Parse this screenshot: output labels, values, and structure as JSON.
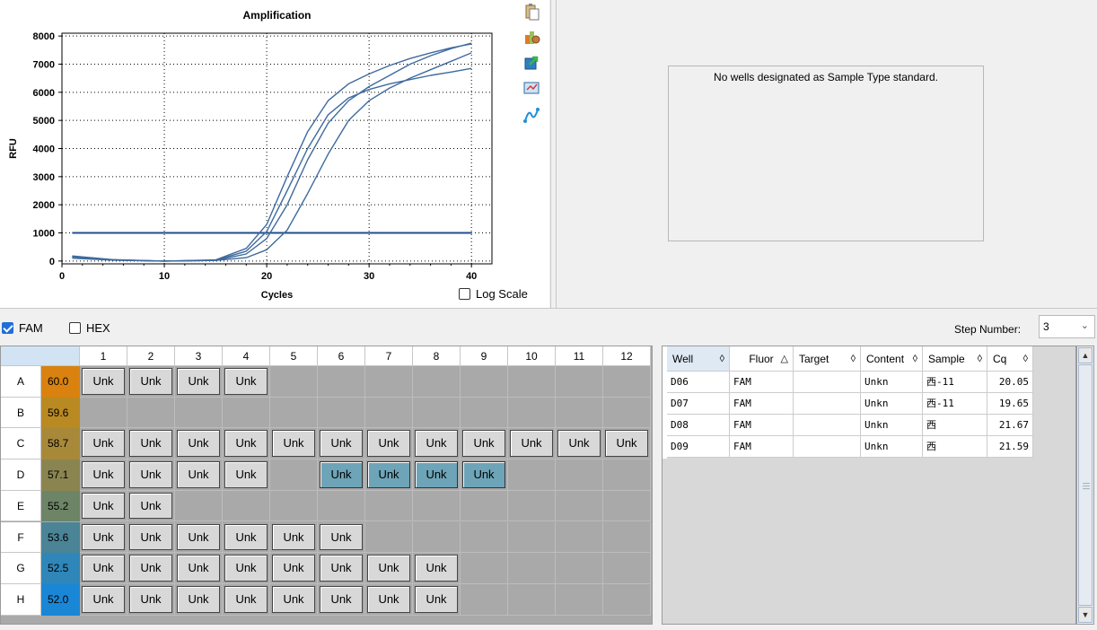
{
  "chart": {
    "title": "Amplification",
    "ylabel": "RFU",
    "xlabel": "Cycles",
    "y_ticks": [
      "8000",
      "7000",
      "6000",
      "5000",
      "4000",
      "3000",
      "2000",
      "1000",
      "0"
    ],
    "x_ticks": [
      "0",
      "10",
      "20",
      "30",
      "40"
    ],
    "log_scale_label": "Log Scale",
    "log_scale_checked": false
  },
  "chart_data": {
    "type": "line",
    "title": "Amplification",
    "xlabel": "Cycles",
    "ylabel": "RFU",
    "xlim": [
      0,
      42
    ],
    "ylim": [
      -100,
      8100
    ],
    "grid": true,
    "threshold": 1000,
    "curves_note": "4 sigmoid curves (wells D06, D07, D08, D09)",
    "series": [
      {
        "x": [
          1,
          5,
          10,
          15,
          18,
          20,
          22,
          24,
          26,
          28,
          30,
          32,
          34,
          36,
          38,
          40
        ],
        "y": [
          150,
          40,
          0,
          20,
          250,
          800,
          2000,
          3600,
          4900,
          5700,
          6200,
          6600,
          7000,
          7300,
          7550,
          7750
        ]
      },
      {
        "x": [
          1,
          5,
          10,
          15,
          18,
          20,
          22,
          24,
          26,
          28,
          30,
          32,
          34,
          36,
          38,
          40
        ],
        "y": [
          100,
          30,
          0,
          30,
          350,
          1050,
          2500,
          4000,
          5200,
          5800,
          6100,
          6300,
          6450,
          6600,
          6720,
          6850
        ]
      },
      {
        "x": [
          1,
          5,
          10,
          15,
          18,
          20,
          22,
          24,
          26,
          28,
          30,
          32,
          34,
          36,
          38,
          40
        ],
        "y": [
          150,
          40,
          0,
          20,
          120,
          400,
          1100,
          2400,
          3800,
          5000,
          5700,
          6150,
          6500,
          6800,
          7100,
          7400
        ]
      },
      {
        "x": [
          1,
          5,
          10,
          15,
          18,
          20,
          22,
          24,
          26,
          28,
          30,
          32,
          34,
          36,
          38,
          40
        ],
        "y": [
          180,
          50,
          0,
          40,
          450,
          1300,
          3000,
          4600,
          5700,
          6300,
          6650,
          6950,
          7200,
          7400,
          7580,
          7720
        ]
      }
    ]
  },
  "standard_panel": {
    "message": "No wells designated as Sample Type standard."
  },
  "fluors": [
    {
      "label": "FAM",
      "checked": true
    },
    {
      "label": "HEX",
      "checked": false
    }
  ],
  "step": {
    "label": "Step Number:",
    "value": "3"
  },
  "plate": {
    "columns": [
      "1",
      "2",
      "3",
      "4",
      "5",
      "6",
      "7",
      "8",
      "9",
      "10",
      "11",
      "12"
    ],
    "rows": [
      {
        "label": "A",
        "temp": "60.0",
        "color": "#d9820f",
        "wells": [
          "Unk",
          "Unk",
          "Unk",
          "Unk",
          "",
          "",
          "",
          "",
          "",
          "",
          "",
          ""
        ],
        "selected": []
      },
      {
        "label": "B",
        "temp": "59.6",
        "color": "#b98a22",
        "wells": [
          "",
          "",
          "",
          "",
          "",
          "",
          "",
          "",
          "",
          "",
          "",
          ""
        ],
        "selected": []
      },
      {
        "label": "C",
        "temp": "58.7",
        "color": "#a8893a",
        "wells": [
          "Unk",
          "Unk",
          "Unk",
          "Unk",
          "Unk",
          "Unk",
          "Unk",
          "Unk",
          "Unk",
          "Unk",
          "Unk",
          "Unk"
        ],
        "selected": []
      },
      {
        "label": "D",
        "temp": "57.1",
        "color": "#8a8550",
        "wells": [
          "Unk",
          "Unk",
          "Unk",
          "Unk",
          "",
          "Unk",
          "Unk",
          "Unk",
          "Unk",
          "",
          "",
          ""
        ],
        "selected": [
          5,
          6,
          7,
          8
        ]
      },
      {
        "label": "E",
        "temp": "55.2",
        "color": "#6d8467",
        "wells": [
          "Unk",
          "Unk",
          "",
          "",
          "",
          "",
          "",
          "",
          "",
          "",
          "",
          ""
        ],
        "selected": []
      },
      {
        "label": "F",
        "temp": "53.6",
        "color": "#4a8496",
        "wells": [
          "Unk",
          "Unk",
          "Unk",
          "Unk",
          "Unk",
          "Unk",
          "",
          "",
          "",
          "",
          "",
          ""
        ],
        "selected": []
      },
      {
        "label": "G",
        "temp": "52.5",
        "color": "#2f86b8",
        "wells": [
          "Unk",
          "Unk",
          "Unk",
          "Unk",
          "Unk",
          "Unk",
          "Unk",
          "Unk",
          "",
          "",
          "",
          ""
        ],
        "selected": []
      },
      {
        "label": "H",
        "temp": "52.0",
        "color": "#1a86d6",
        "wells": [
          "Unk",
          "Unk",
          "Unk",
          "Unk",
          "Unk",
          "Unk",
          "Unk",
          "Unk",
          "",
          "",
          "",
          ""
        ],
        "selected": []
      }
    ]
  },
  "table": {
    "headers": [
      {
        "label": "Well",
        "sort": "◊"
      },
      {
        "label": "Fluor",
        "sort": "△"
      },
      {
        "label": "Target",
        "sort": "◊"
      },
      {
        "label": "Content",
        "sort": "◊"
      },
      {
        "label": "Sample",
        "sort": "◊"
      },
      {
        "label": "Cq",
        "sort": "◊"
      }
    ],
    "rows": [
      [
        "D06",
        "FAM",
        "",
        "Unkn",
        "西-11",
        "20.05"
      ],
      [
        "D07",
        "FAM",
        "",
        "Unkn",
        "西-11",
        "19.65"
      ],
      [
        "D08",
        "FAM",
        "",
        "Unkn",
        "西",
        "21.67"
      ],
      [
        "D09",
        "FAM",
        "",
        "Unkn",
        "西",
        "21.59"
      ]
    ]
  },
  "icons": [
    "clipboard-icon",
    "settings-icon",
    "export-icon",
    "zoom-icon",
    "curve-icon"
  ],
  "colors": {
    "curve": "#3e6a9e",
    "threshold": "#1f4f8f",
    "selected_well": "#6da4b7",
    "accent": "#1e6fd9"
  }
}
